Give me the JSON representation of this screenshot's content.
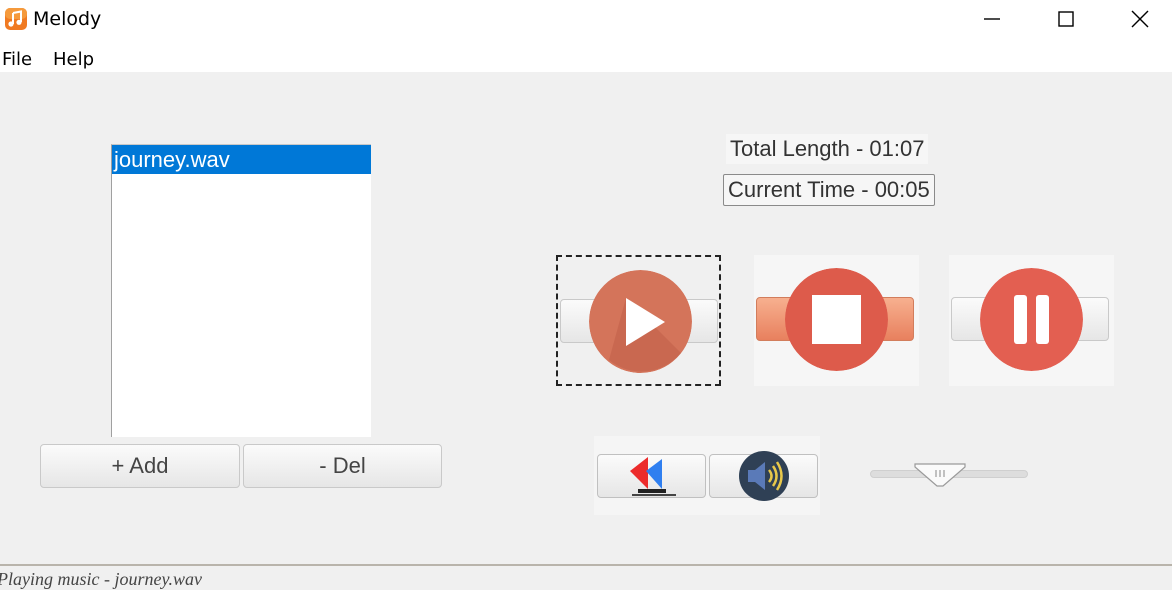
{
  "window": {
    "title": "Melody",
    "icon": "music-note-icon",
    "controls": [
      "minimize-icon",
      "maximize-icon",
      "close-icon"
    ]
  },
  "menu": {
    "items": [
      {
        "label": "File"
      },
      {
        "label": "Help"
      }
    ]
  },
  "playlist": {
    "items": [
      {
        "label": "journey.wav",
        "selected": true
      }
    ],
    "add_label": "+ Add",
    "del_label": "- Del"
  },
  "info": {
    "total_length": "Total Length - 01:07",
    "current_time": "Current Time - 00:05"
  },
  "controls": {
    "play": {
      "icon": "play-icon",
      "color": "#d4745a"
    },
    "stop": {
      "icon": "stop-icon",
      "color": "#dd5b4b"
    },
    "pause": {
      "icon": "pause-icon",
      "color": "#e35f51"
    },
    "rewind": {
      "icon": "rewind-icon"
    },
    "mute": {
      "icon": "speaker-icon"
    }
  },
  "volume": {
    "level_percent": 45
  },
  "status": {
    "text": "Playing music - journey.wav"
  },
  "colors": {
    "selection": "#0078d7",
    "panel_bg": "#f0f0f0",
    "accent_orange": "#e8805e"
  }
}
